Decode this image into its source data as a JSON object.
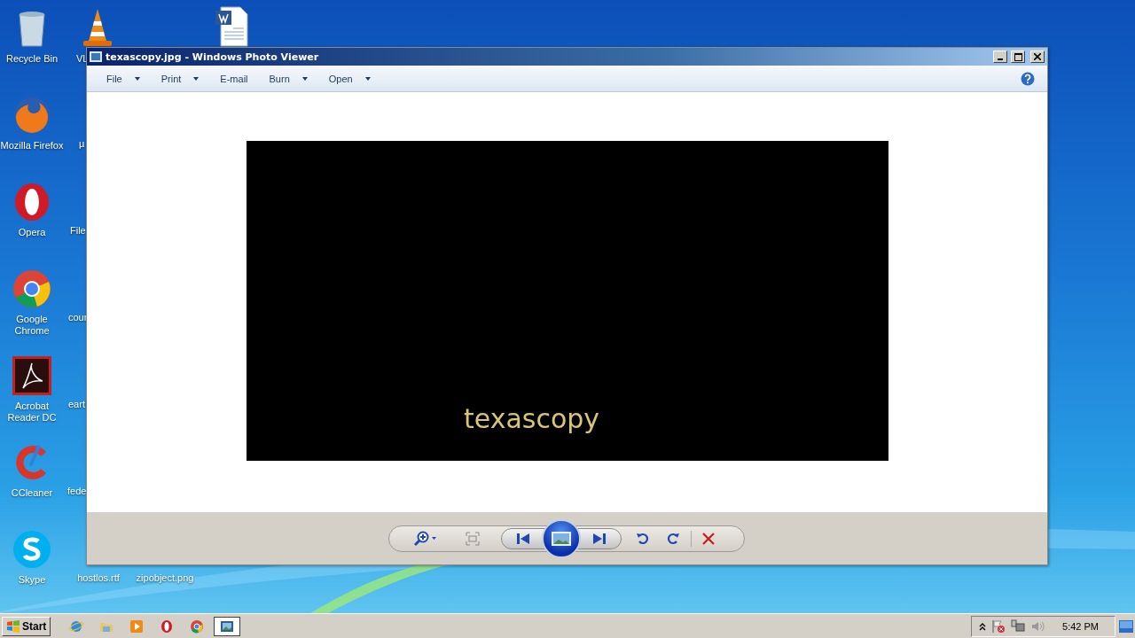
{
  "desktop_icons": [
    {
      "kind": "recycle",
      "label": "Recycle Bin"
    },
    {
      "kind": "firefox",
      "label": "Mozilla Firefox"
    },
    {
      "kind": "opera",
      "label": "Opera"
    },
    {
      "kind": "chrome",
      "label": "Google Chrome"
    },
    {
      "kind": "acrobat",
      "label": "Acrobat Reader DC"
    },
    {
      "kind": "ccleaner",
      "label": "CCleaner"
    },
    {
      "kind": "skype",
      "label": "Skype"
    },
    {
      "kind": "vlc",
      "label": "VL"
    },
    {
      "label": "µ"
    },
    {
      "label": "File"
    },
    {
      "label": "cour"
    },
    {
      "label": "eart"
    },
    {
      "label": "fede"
    },
    {
      "label": "hostlos.rtf"
    },
    {
      "label": "zipobject.png"
    },
    {
      "kind": "word"
    }
  ],
  "window": {
    "title": "texascopy.jpg - Windows Photo Viewer",
    "menu": [
      {
        "label": "File",
        "dropdown": true
      },
      {
        "label": "Print",
        "dropdown": true
      },
      {
        "label": "E-mail",
        "dropdown": false
      },
      {
        "label": "Burn",
        "dropdown": true
      },
      {
        "label": "Open",
        "dropdown": true
      }
    ],
    "image_text": "texascopy"
  },
  "taskbar": {
    "start": "Start",
    "apps": [
      {
        "kind": "ie",
        "selected": false
      },
      {
        "kind": "folder",
        "selected": false
      },
      {
        "kind": "media",
        "selected": false
      },
      {
        "kind": "opera",
        "selected": false
      },
      {
        "kind": "chrome",
        "selected": false
      },
      {
        "kind": "photos",
        "selected": true
      }
    ],
    "clock": "5:42 PM"
  }
}
